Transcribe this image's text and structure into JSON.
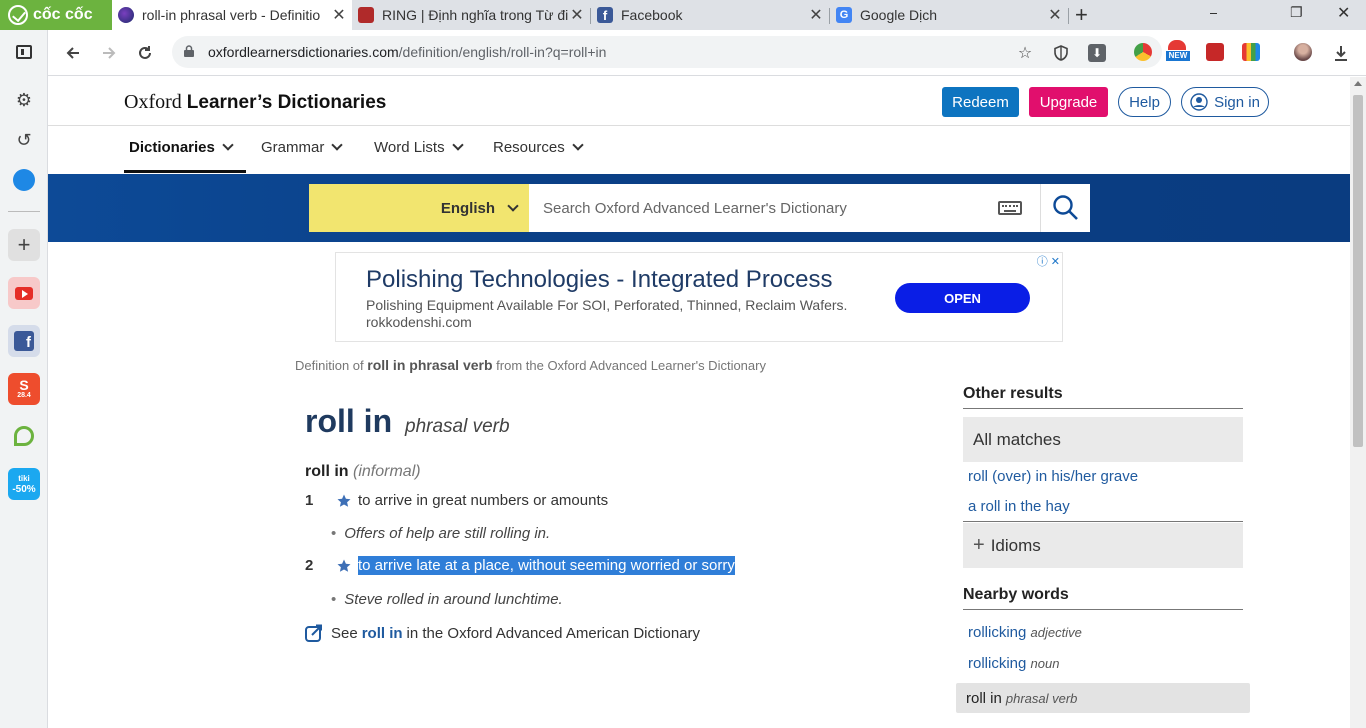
{
  "browser": {
    "brand": "cốc cốc",
    "tabs": [
      {
        "title": "roll-in phrasal verb - Definitio",
        "active": true
      },
      {
        "title": "RING | Định nghĩa trong Từ đi",
        "active": false
      },
      {
        "title": "Facebook",
        "active": false
      },
      {
        "title": "Google Dịch",
        "active": false
      }
    ],
    "url_host": "oxfordlearnersdictionaries.com",
    "url_path": "/definition/english/roll-in?q=roll+in",
    "ext_badge": "NEW",
    "sidebar_badges": {
      "shopee": "28.4",
      "tiki_top": "tiki",
      "tiki_bottom": "-50%"
    }
  },
  "site": {
    "logo_serif": "Oxford",
    "logo_bold": "Learner’s Dictionaries",
    "header_buttons": {
      "redeem": "Redeem",
      "upgrade": "Upgrade",
      "help": "Help",
      "signin": "Sign in"
    },
    "nav": [
      "Dictionaries",
      "Grammar",
      "Word Lists",
      "Resources"
    ],
    "search": {
      "language": "English",
      "placeholder": "Search Oxford Advanced Learner's Dictionary"
    }
  },
  "ad": {
    "headline": "Polishing Technologies - Integrated Process",
    "description": "Polishing Equipment Available For SOI, Perforated, Thinned, Reclaim Wafers.",
    "site": "rokkodenshi.com",
    "cta": "OPEN"
  },
  "entry": {
    "source_prefix": "Definition of ",
    "source_term": "roll in phrasal verb",
    "source_suffix": " from the Oxford Advanced Learner's Dictionary",
    "headword": "roll in",
    "pos": "phrasal verb",
    "phrase": "roll in",
    "register": "(informal)",
    "senses": [
      {
        "num": "1",
        "def": "to arrive in great numbers or amounts",
        "example": "Offers of help are still rolling in."
      },
      {
        "num": "2",
        "def": "to arrive late at a place, without seeming worried or sorry",
        "example": "Steve rolled in around lunchtime."
      }
    ],
    "see_also": {
      "prefix": "See",
      "term": "roll in",
      "suffix": "in the Oxford Advanced American Dictionary"
    }
  },
  "sidebar": {
    "other_results_title": "Other results",
    "all_matches": "All matches",
    "matches": [
      "roll (over) in his/her grave",
      "a roll in the hay"
    ],
    "idioms": "Idioms",
    "nearby_title": "Nearby words",
    "nearby": [
      {
        "word": "rollicking",
        "pos": "adjective"
      },
      {
        "word": "rollicking",
        "pos": "noun"
      }
    ],
    "current": {
      "word": "roll in",
      "pos": "phrasal verb"
    }
  },
  "colors": {
    "brand_green": "#6cb33f",
    "oxford_blue": "#0d4a97",
    "lang_yellow": "#f2e56f",
    "redeem_blue": "#0d74c0",
    "upgrade_pink": "#e10f6d",
    "highlight": "#2f7ed8"
  }
}
